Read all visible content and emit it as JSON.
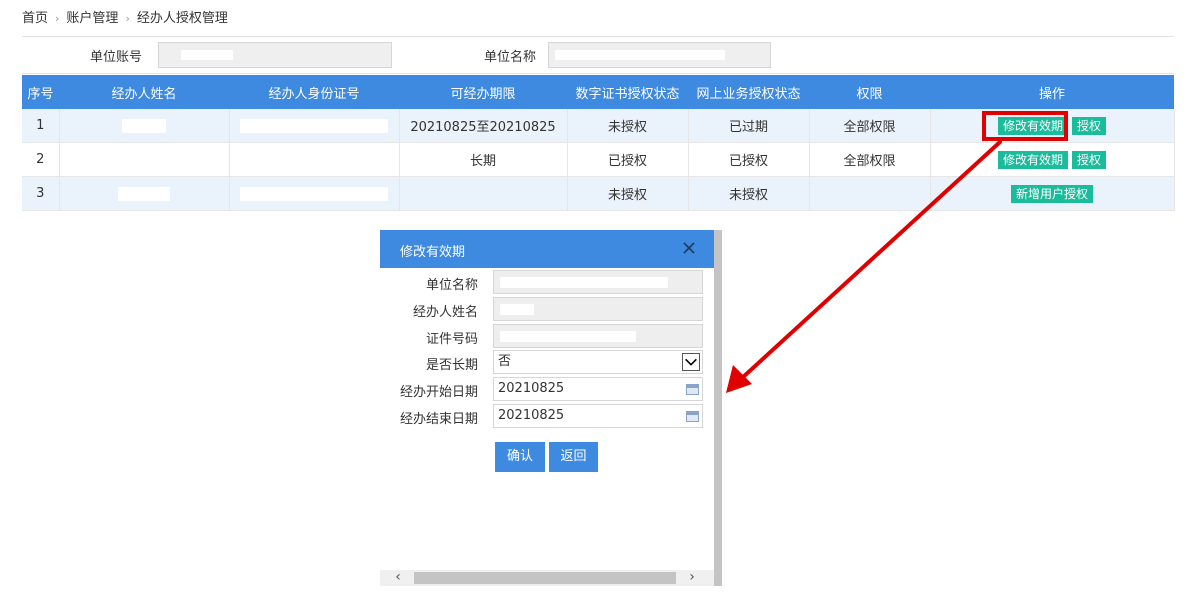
{
  "breadcrumb": [
    "首页",
    "账户管理",
    "经办人授权管理"
  ],
  "info": {
    "account_label": "单位账号",
    "name_label": "单位名称"
  },
  "table": {
    "headers": [
      "序号",
      "经办人姓名",
      "经办人身份证号",
      "可经办期限",
      "数字证书授权状态",
      "网上业务授权状态",
      "权限",
      "操作"
    ],
    "rows": [
      {
        "no": "1",
        "period": "20210825至20210825",
        "cert": "未授权",
        "online": "已过期",
        "perm": "全部权限",
        "actions": [
          "修改有效期",
          "授权"
        ]
      },
      {
        "no": "2",
        "period": "长期",
        "cert": "已授权",
        "online": "已授权",
        "perm": "全部权限",
        "actions": [
          "修改有效期",
          "授权"
        ]
      },
      {
        "no": "3",
        "period": "",
        "cert": "未授权",
        "online": "未授权",
        "perm": "",
        "actions": [
          "新增用户授权"
        ]
      }
    ]
  },
  "dialog": {
    "title": "修改有效期",
    "fields": {
      "unit_name_label": "单位名称",
      "agent_name_label": "经办人姓名",
      "cert_no_label": "证件号码",
      "long_term_label": "是否长期",
      "long_term_value": "否",
      "start_label": "经办开始日期",
      "start_value": "20210825",
      "end_label": "经办结束日期",
      "end_value": "20210825"
    },
    "confirm": "确认",
    "back": "返回"
  },
  "colors": {
    "header_blue": "#3d8ae0",
    "action_green": "#1abc9c",
    "highlight_red": "#e00000"
  }
}
